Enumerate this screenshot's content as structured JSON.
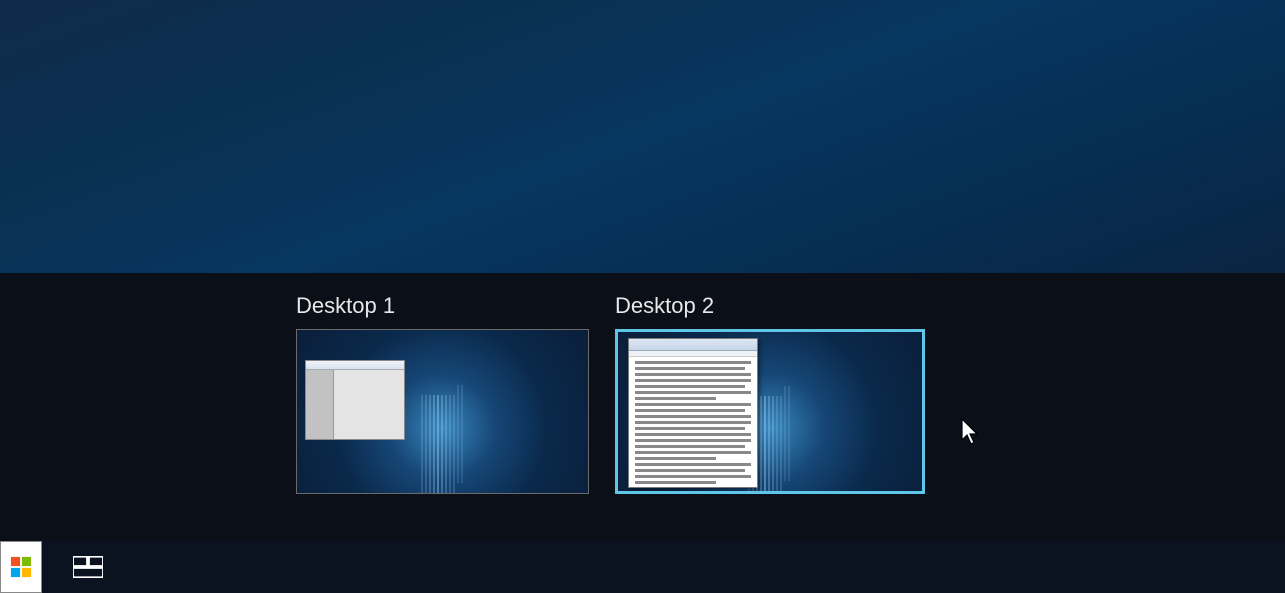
{
  "desktops": [
    {
      "label": "Desktop 1",
      "selected": false
    },
    {
      "label": "Desktop 2",
      "selected": true
    }
  ],
  "taskbar": {
    "start": "Start",
    "task_view": "Task View"
  },
  "colors": {
    "selection": "#5fc6e8",
    "panel": "#0a0f18",
    "taskbar": "#0c1320"
  }
}
